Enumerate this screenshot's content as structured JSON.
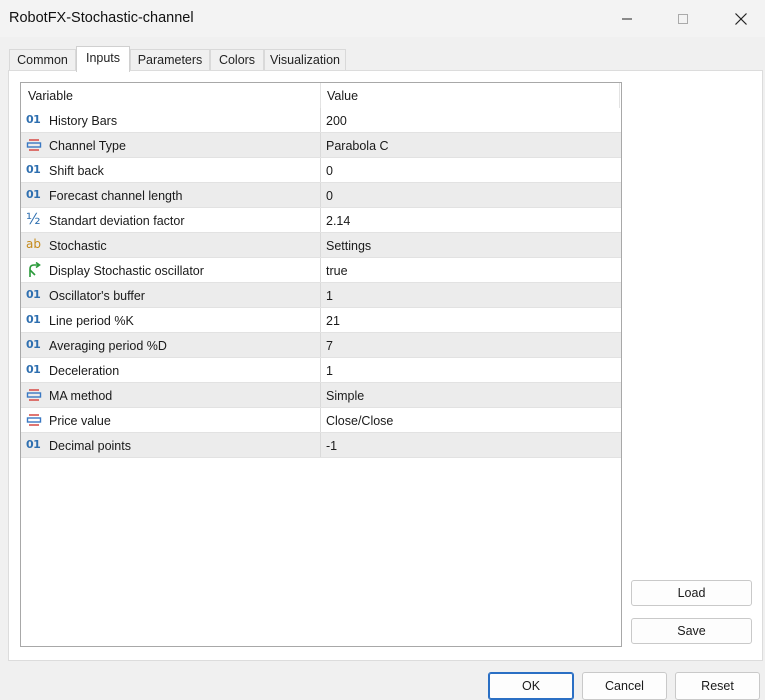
{
  "window": {
    "title": "RobotFX-Stochastic-channel"
  },
  "tabs": [
    {
      "label": "Common"
    },
    {
      "label": "Inputs"
    },
    {
      "label": "Parameters"
    },
    {
      "label": "Colors"
    },
    {
      "label": "Visualization"
    }
  ],
  "grid": {
    "headers": {
      "variable": "Variable",
      "value": "Value"
    },
    "rows": [
      {
        "name": "History Bars",
        "value": "200",
        "icon": "integer-icon",
        "icon_text": "01"
      },
      {
        "name": "Channel Type",
        "value": "Parabola C",
        "icon": "enum-icon"
      },
      {
        "name": "Shift back",
        "value": "0",
        "icon": "integer-icon",
        "icon_text": "01"
      },
      {
        "name": "Forecast channel length",
        "value": "0",
        "icon": "integer-icon",
        "icon_text": "01"
      },
      {
        "name": "Standart deviation factor",
        "value": "2.14",
        "icon": "double-icon",
        "icon_text": "½"
      },
      {
        "name": "Stochastic",
        "value": "Settings",
        "icon": "string-icon",
        "icon_text": "ab"
      },
      {
        "name": "Display Stochastic oscillator",
        "value": "true",
        "icon": "bool-icon"
      },
      {
        "name": "Oscillator's buffer",
        "value": "1",
        "icon": "integer-icon",
        "icon_text": "01"
      },
      {
        "name": "Line period %K",
        "value": "21",
        "icon": "integer-icon",
        "icon_text": "01"
      },
      {
        "name": "Averaging period %D",
        "value": "7",
        "icon": "integer-icon",
        "icon_text": "01"
      },
      {
        "name": "Deceleration",
        "value": "1",
        "icon": "integer-icon",
        "icon_text": "01"
      },
      {
        "name": "MA method",
        "value": "Simple",
        "icon": "enum-icon"
      },
      {
        "name": "Price value",
        "value": "Close/Close",
        "icon": "enum-icon"
      },
      {
        "name": "Decimal points",
        "value": "-1",
        "icon": "integer-icon",
        "icon_text": "01"
      }
    ]
  },
  "buttons": {
    "load": "Load",
    "save": "Save",
    "ok": "OK",
    "cancel": "Cancel",
    "reset": "Reset"
  },
  "colors": {
    "accent": "#2a6fc4",
    "integer_icon": "#2e6fb0",
    "string_icon": "#c58a1a",
    "bool_icon": "#2a9a3a",
    "enum_icon_red": "#d9534f",
    "enum_icon_blue": "#3a78c2"
  }
}
